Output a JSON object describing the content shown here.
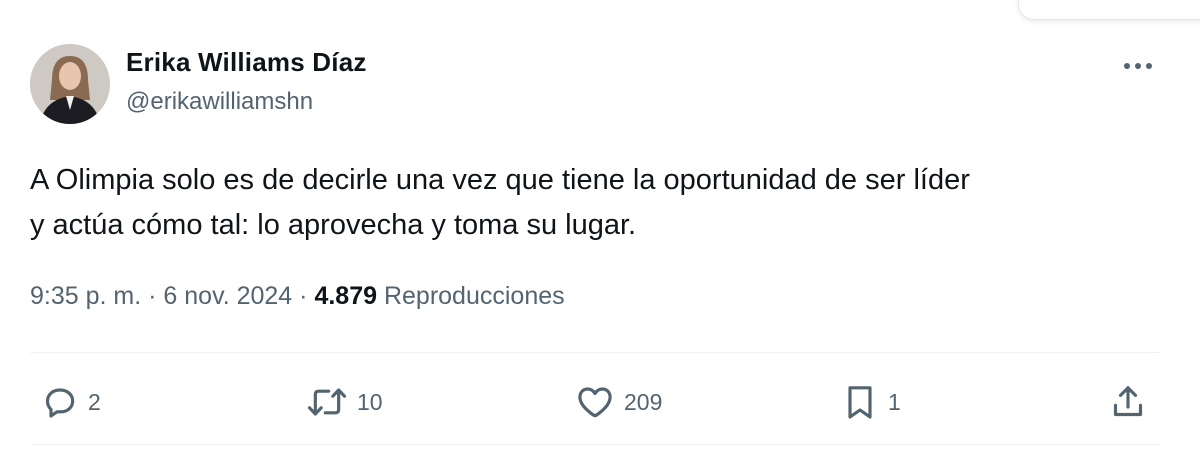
{
  "author": {
    "display_name": "Erika Williams Díaz",
    "handle": "@erikawilliamshn"
  },
  "tweet": {
    "text_line1": "A Olimpia solo es de decirle una vez que tiene la oportunidad de ser líder",
    "text_line2": "y actúa cómo tal: lo aprovecha y toma su lugar.",
    "time": "9:35 p. m.",
    "separator": "·",
    "date": "6 nov. 2024",
    "views_count": "4.879",
    "views_label": "Reproducciones"
  },
  "actions": {
    "replies": "2",
    "retweets": "10",
    "likes": "209",
    "bookmarks": "1"
  },
  "icons": {
    "more": "more-horizontal-icon",
    "reply": "reply-icon",
    "retweet": "retweet-icon",
    "like": "heart-icon",
    "bookmark": "bookmark-icon",
    "share": "share-icon"
  },
  "colors": {
    "text_primary": "#0f1419",
    "text_secondary": "#536471",
    "divider": "#eff3f4"
  }
}
